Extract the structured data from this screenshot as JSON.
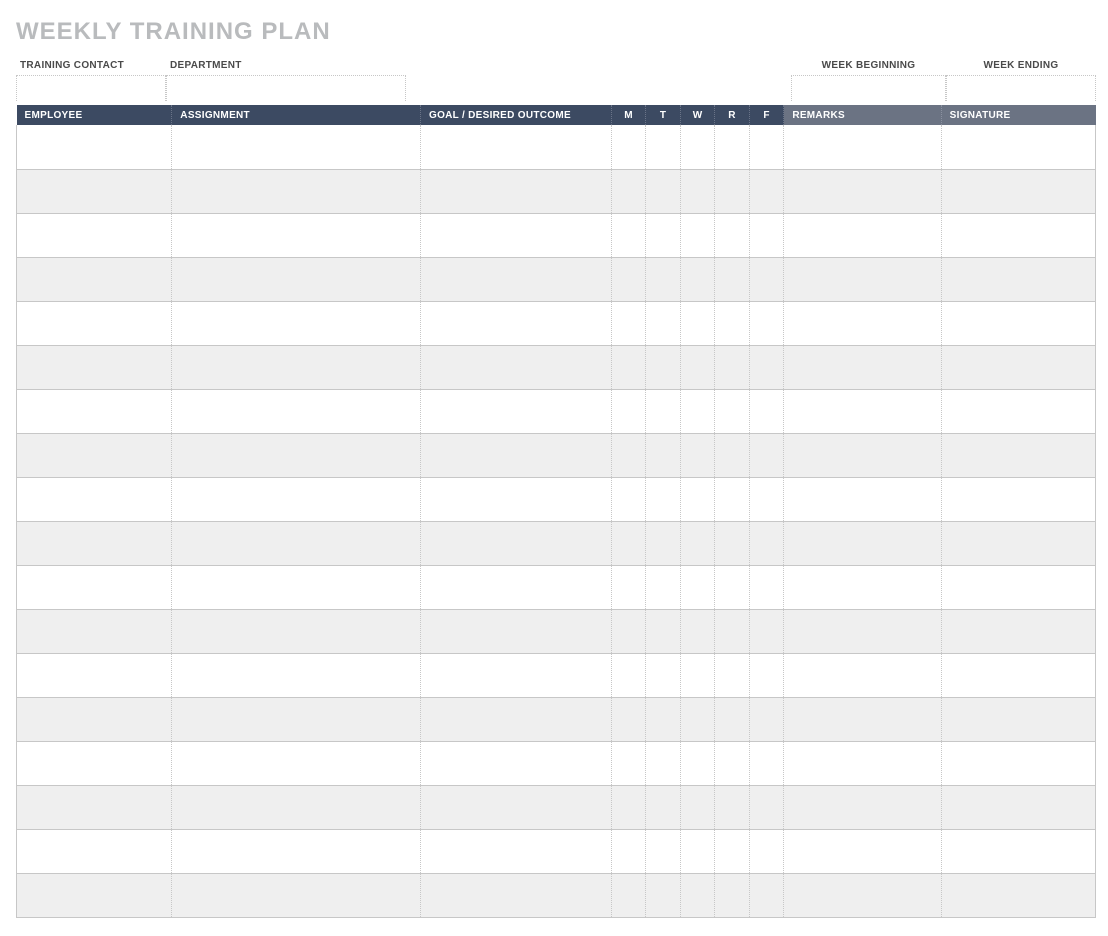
{
  "title": "WEEKLY TRAINING PLAN",
  "meta": {
    "training_contact": {
      "label": "TRAINING CONTACT",
      "value": ""
    },
    "department": {
      "label": "DEPARTMENT",
      "value": ""
    },
    "week_beginning": {
      "label": "WEEK BEGINNING",
      "value": ""
    },
    "week_ending": {
      "label": "WEEK ENDING",
      "value": ""
    }
  },
  "columns": {
    "employee": "EMPLOYEE",
    "assignment": "ASSIGNMENT",
    "goal": "GOAL / DESIRED OUTCOME",
    "m": "M",
    "t": "T",
    "w": "W",
    "r": "R",
    "f": "F",
    "remarks": "REMARKS",
    "signature": "SIGNATURE"
  },
  "rows": [
    {
      "employee": "",
      "assignment": "",
      "goal": "",
      "m": "",
      "t": "",
      "w": "",
      "r": "",
      "f": "",
      "remarks": "",
      "signature": ""
    },
    {
      "employee": "",
      "assignment": "",
      "goal": "",
      "m": "",
      "t": "",
      "w": "",
      "r": "",
      "f": "",
      "remarks": "",
      "signature": ""
    },
    {
      "employee": "",
      "assignment": "",
      "goal": "",
      "m": "",
      "t": "",
      "w": "",
      "r": "",
      "f": "",
      "remarks": "",
      "signature": ""
    },
    {
      "employee": "",
      "assignment": "",
      "goal": "",
      "m": "",
      "t": "",
      "w": "",
      "r": "",
      "f": "",
      "remarks": "",
      "signature": ""
    },
    {
      "employee": "",
      "assignment": "",
      "goal": "",
      "m": "",
      "t": "",
      "w": "",
      "r": "",
      "f": "",
      "remarks": "",
      "signature": ""
    },
    {
      "employee": "",
      "assignment": "",
      "goal": "",
      "m": "",
      "t": "",
      "w": "",
      "r": "",
      "f": "",
      "remarks": "",
      "signature": ""
    },
    {
      "employee": "",
      "assignment": "",
      "goal": "",
      "m": "",
      "t": "",
      "w": "",
      "r": "",
      "f": "",
      "remarks": "",
      "signature": ""
    },
    {
      "employee": "",
      "assignment": "",
      "goal": "",
      "m": "",
      "t": "",
      "w": "",
      "r": "",
      "f": "",
      "remarks": "",
      "signature": ""
    },
    {
      "employee": "",
      "assignment": "",
      "goal": "",
      "m": "",
      "t": "",
      "w": "",
      "r": "",
      "f": "",
      "remarks": "",
      "signature": ""
    },
    {
      "employee": "",
      "assignment": "",
      "goal": "",
      "m": "",
      "t": "",
      "w": "",
      "r": "",
      "f": "",
      "remarks": "",
      "signature": ""
    },
    {
      "employee": "",
      "assignment": "",
      "goal": "",
      "m": "",
      "t": "",
      "w": "",
      "r": "",
      "f": "",
      "remarks": "",
      "signature": ""
    },
    {
      "employee": "",
      "assignment": "",
      "goal": "",
      "m": "",
      "t": "",
      "w": "",
      "r": "",
      "f": "",
      "remarks": "",
      "signature": ""
    },
    {
      "employee": "",
      "assignment": "",
      "goal": "",
      "m": "",
      "t": "",
      "w": "",
      "r": "",
      "f": "",
      "remarks": "",
      "signature": ""
    },
    {
      "employee": "",
      "assignment": "",
      "goal": "",
      "m": "",
      "t": "",
      "w": "",
      "r": "",
      "f": "",
      "remarks": "",
      "signature": ""
    },
    {
      "employee": "",
      "assignment": "",
      "goal": "",
      "m": "",
      "t": "",
      "w": "",
      "r": "",
      "f": "",
      "remarks": "",
      "signature": ""
    },
    {
      "employee": "",
      "assignment": "",
      "goal": "",
      "m": "",
      "t": "",
      "w": "",
      "r": "",
      "f": "",
      "remarks": "",
      "signature": ""
    },
    {
      "employee": "",
      "assignment": "",
      "goal": "",
      "m": "",
      "t": "",
      "w": "",
      "r": "",
      "f": "",
      "remarks": "",
      "signature": ""
    },
    {
      "employee": "",
      "assignment": "",
      "goal": "",
      "m": "",
      "t": "",
      "w": "",
      "r": "",
      "f": "",
      "remarks": "",
      "signature": ""
    }
  ]
}
